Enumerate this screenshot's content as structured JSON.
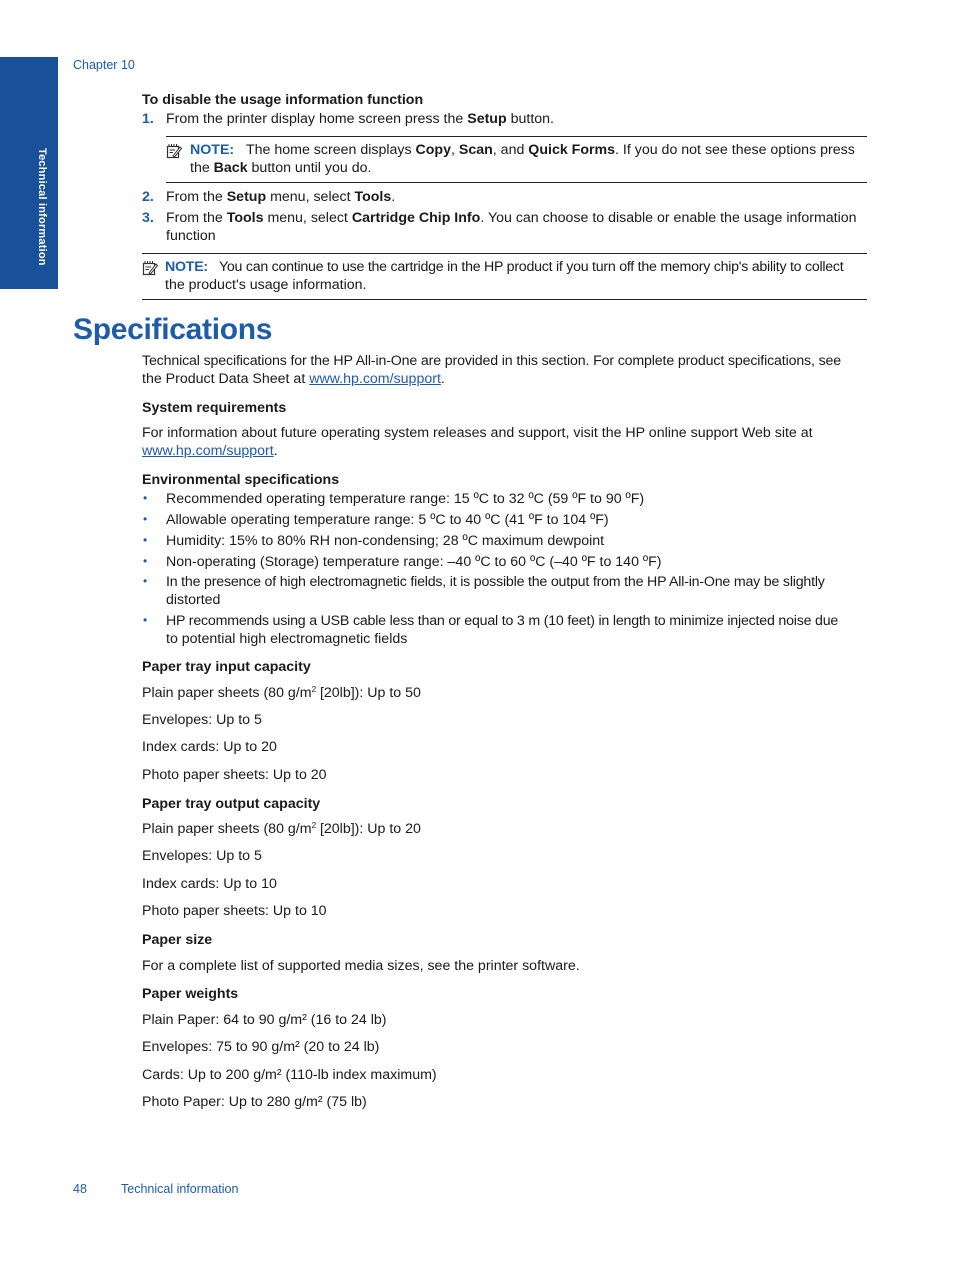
{
  "header": {
    "chapter": "Chapter 10"
  },
  "side_tab": {
    "label": "Technical information",
    "color": "#19509a"
  },
  "procedure": {
    "heading": "To disable the usage information function",
    "steps": [
      {
        "num": "1.",
        "pre": "From the printer display home screen press the ",
        "b1": "Setup",
        "post": " button."
      },
      {
        "num": "2.",
        "pre": "From the ",
        "b1": "Setup",
        "mid": " menu, select ",
        "b2": "Tools",
        "post": "."
      },
      {
        "num": "3.",
        "pre": "From the ",
        "b1": "Tools",
        "mid": " menu, select ",
        "b2": "Cartridge Chip Info",
        "post": ". You can choose to disable or enable the usage information",
        "line2": "function"
      }
    ],
    "note1": {
      "label": "NOTE:",
      "pre": "The home screen displays ",
      "b1": "Copy",
      "s1": ", ",
      "b2": "Scan",
      "s2": ", and ",
      "b3": "Quick Forms",
      "post": ". If you do not see these options press",
      "line2_pre": "the ",
      "line2_b": "Back",
      "line2_post": " button until you do."
    },
    "note2": {
      "label": "NOTE:",
      "text": "You can continue to use the cartridge in the HP product if you turn off the memory chip's ability to collect",
      "line2": "the product's usage information."
    }
  },
  "specs": {
    "title": "Specifications",
    "intro_line1": "Technical specifications for the HP All-in-One are provided in this section. For complete product specifications, see",
    "intro_line2_pre": "the Product Data Sheet at ",
    "intro_link": "www.hp.com/support",
    "intro_line2_post": ".",
    "system": {
      "heading": "System requirements",
      "line1": "For information about future operating system releases and support, visit the HP online support Web site at",
      "link": "www.hp.com/support",
      "post": "."
    },
    "environmental": {
      "heading": "Environmental specifications",
      "items": [
        {
          "line1": "Recommended operating temperature range: 15 ºC to 32 ºC (59 ºF to 90 ºF)"
        },
        {
          "line1": "Allowable operating temperature range: 5 ºC to 40 ºC (41 ºF to 104 ºF)"
        },
        {
          "line1": "Humidity: 15% to 80% RH non-condensing; 28 ºC maximum dewpoint"
        },
        {
          "line1": "Non-operating (Storage) temperature range: –40 ºC to 60 ºC (–40 ºF to 140 ºF)"
        },
        {
          "line1": "In the presence of high electromagnetic fields, it is possible the output from the HP All-in-One may be slightly",
          "line2": "distorted"
        },
        {
          "line1": "HP recommends using a USB cable less than or equal to 3 m (10 feet) in length to minimize injected noise due",
          "line2": "to potential high electromagnetic fields"
        }
      ]
    },
    "input_capacity": {
      "heading": "Paper tray input capacity",
      "plain_pre": "Plain paper sheets (80 g/m",
      "plain_sup": "2",
      "plain_post": " [20lb]): Up to 50",
      "items": [
        "Envelopes: Up to 5",
        "Index cards: Up to 20",
        "Photo paper sheets: Up to 20"
      ]
    },
    "output_capacity": {
      "heading": "Paper tray output capacity",
      "plain_pre": "Plain paper sheets (80 g/m",
      "plain_sup": "2",
      "plain_post": " [20lb]): Up to 20",
      "items": [
        "Envelopes: Up to 5",
        "Index cards: Up to 10",
        "Photo paper sheets: Up to 10"
      ]
    },
    "paper_size": {
      "heading": "Paper size",
      "text": "For a complete list of supported media sizes, see the printer software."
    },
    "paper_weights": {
      "heading": "Paper weights",
      "items": [
        "Plain Paper: 64 to 90 g/m² (16 to 24 lb)",
        "Envelopes: 75 to 90 g/m² (20 to 24 lb)",
        "Cards: Up to 200 g/m² (110-lb index maximum)",
        "Photo Paper: Up to 280 g/m² (75 lb)"
      ]
    }
  },
  "footer": {
    "page_number": "48",
    "section": "Technical information"
  }
}
